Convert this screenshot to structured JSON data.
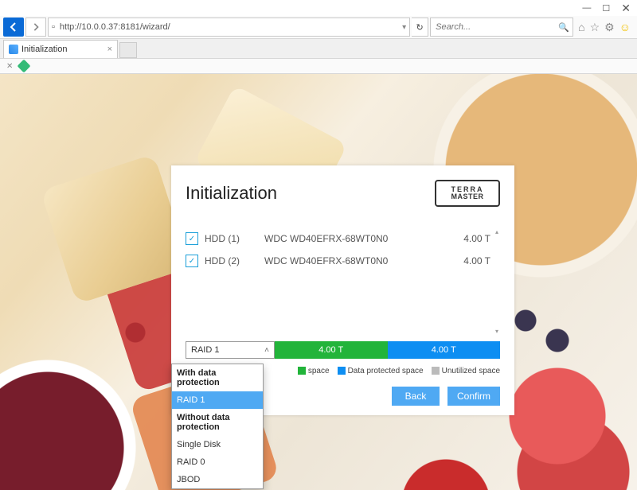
{
  "window_controls": {
    "min": "—",
    "max": "☐",
    "close": "✕"
  },
  "url": "http://10.0.0.37:8181/wizard/",
  "search_placeholder": "Search...",
  "tab_title": "Initialization",
  "wizard": {
    "title": "Initialization",
    "logo_line1": "TERRA",
    "logo_line2": "MASTER",
    "hdds": [
      {
        "name": "HDD (1)",
        "model": "WDC WD40EFRX-68WT0N0",
        "size": "4.00 T"
      },
      {
        "name": "HDD (2)",
        "model": "WDC WD40EFRX-68WT0N0",
        "size": "4.00 T"
      }
    ],
    "raid_selected": "RAID 1",
    "bar": {
      "avail": "4.00 T",
      "protected": "4.00 T"
    },
    "legend_avail_suffix": "space",
    "legend_prot": "Data protected space",
    "legend_unused": "Unutilized space",
    "btn_back": "Back",
    "btn_confirm": "Confirm"
  },
  "dropdown": {
    "hdr_protected": "With data protection",
    "opt_raid1": "RAID 1",
    "hdr_unprotected": "Without data protection",
    "opt_single": "Single Disk",
    "opt_raid0": "RAID 0",
    "opt_jbod": "JBOD"
  }
}
